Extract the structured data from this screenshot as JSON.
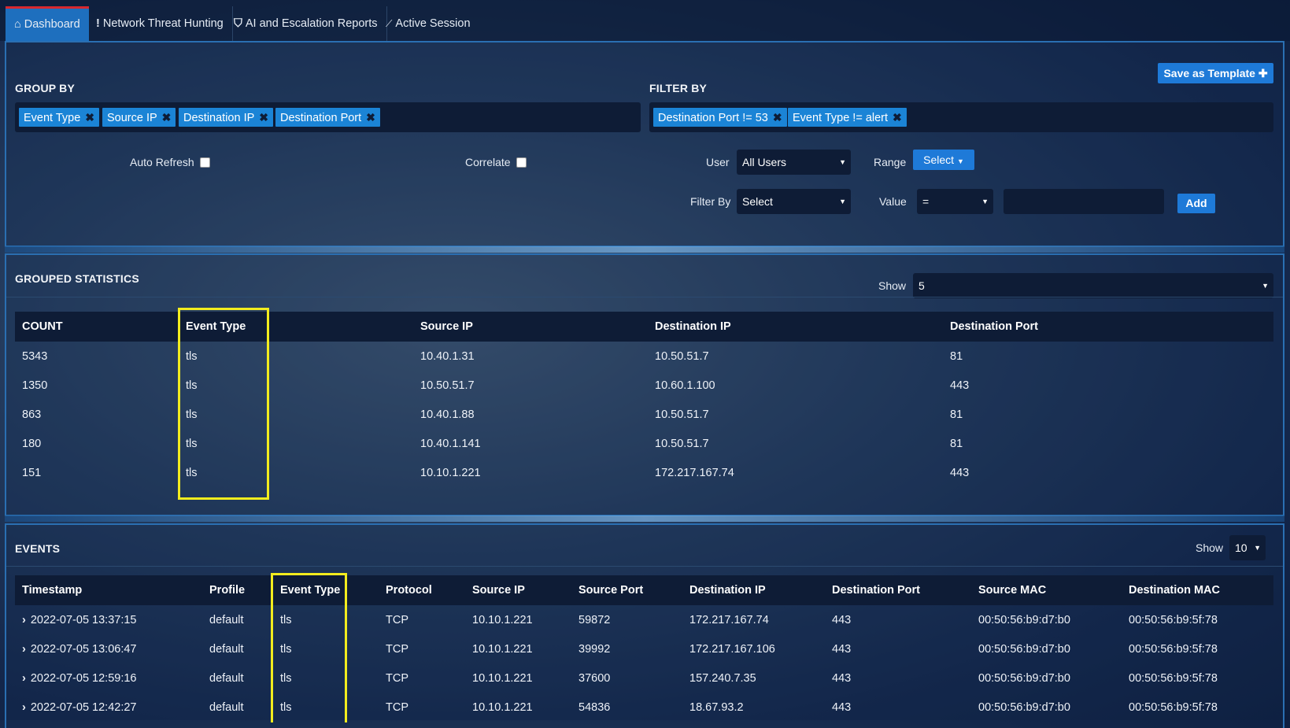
{
  "tabs": [
    {
      "label": "Dashboard",
      "icon": "home-icon",
      "glyph": "⌂"
    },
    {
      "label": "Network Threat Hunting",
      "icon": "exclamation-icon",
      "glyph": "!"
    },
    {
      "label": "AI and Escalation Reports",
      "icon": "shield-icon",
      "glyph": "⛉"
    },
    {
      "label": "Active Session",
      "icon": "line-chart-icon",
      "glyph": "📈"
    }
  ],
  "top": {
    "save_template": "Save as Template ✚",
    "group_by_label": "GROUP BY",
    "filter_by_label": "FILTER BY",
    "group_tags": [
      "Event Type",
      "Source IP",
      "Destination IP",
      "Destination Port"
    ],
    "filter_tags": [
      "Destination Port != 53",
      "Event Type != alert"
    ],
    "auto_refresh": "Auto Refresh",
    "correlate": "Correlate",
    "user_label": "User",
    "user_value": "All Users",
    "range_label": "Range",
    "range_button": "Select",
    "filterby_label": "Filter By",
    "filterby_value": "Select",
    "value_label": "Value",
    "value_op": "=",
    "add_button": "Add"
  },
  "grouped": {
    "title": "GROUPED STATISTICS",
    "show_label": "Show",
    "show_value": "5",
    "columns": [
      "COUNT",
      "Event Type",
      "Source IP",
      "Destination IP",
      "Destination Port"
    ],
    "rows": [
      [
        "5343",
        "tls",
        "10.40.1.31",
        "10.50.51.7",
        "81"
      ],
      [
        "1350",
        "tls",
        "10.50.51.7",
        "10.60.1.100",
        "443"
      ],
      [
        "863",
        "tls",
        "10.40.1.88",
        "10.50.51.7",
        "81"
      ],
      [
        "180",
        "tls",
        "10.40.1.141",
        "10.50.51.7",
        "81"
      ],
      [
        "151",
        "tls",
        "10.10.1.221",
        "172.217.167.74",
        "443"
      ]
    ]
  },
  "events": {
    "title": "EVENTS",
    "show_label": "Show",
    "show_value": "10",
    "columns": [
      "Timestamp",
      "Profile",
      "Event Type",
      "Protocol",
      "Source IP",
      "Source Port",
      "Destination IP",
      "Destination Port",
      "Source MAC",
      "Destination MAC"
    ],
    "rows": [
      [
        "2022-07-05 13:37:15",
        "default",
        "tls",
        "TCP",
        "10.10.1.221",
        "59872",
        "172.217.167.74",
        "443",
        "00:50:56:b9:d7:b0",
        "00:50:56:b9:5f:78"
      ],
      [
        "2022-07-05 13:06:47",
        "default",
        "tls",
        "TCP",
        "10.10.1.221",
        "39992",
        "172.217.167.106",
        "443",
        "00:50:56:b9:d7:b0",
        "00:50:56:b9:5f:78"
      ],
      [
        "2022-07-05 12:59:16",
        "default",
        "tls",
        "TCP",
        "10.10.1.221",
        "37600",
        "157.240.7.35",
        "443",
        "00:50:56:b9:d7:b0",
        "00:50:56:b9:5f:78"
      ],
      [
        "2022-07-05 12:42:27",
        "default",
        "tls",
        "TCP",
        "10.10.1.221",
        "54836",
        "18.67.93.2",
        "443",
        "00:50:56:b9:d7:b0",
        "00:50:56:b9:5f:78"
      ]
    ]
  },
  "colors": {
    "accent": "#1e7ad8",
    "highlight": "#f2ec1e",
    "active_tab_border": "#d8282f"
  }
}
